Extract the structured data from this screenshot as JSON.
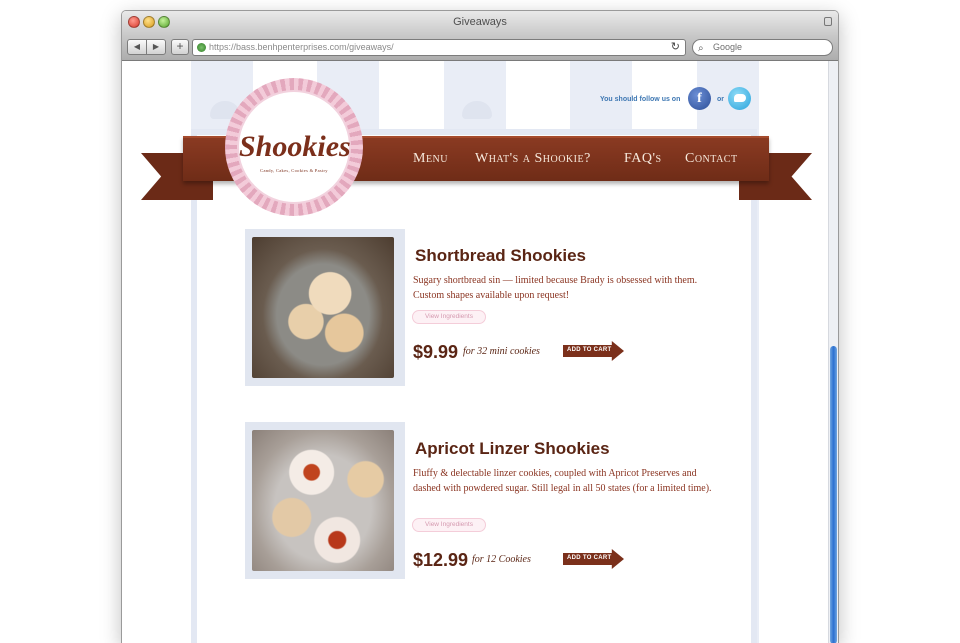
{
  "browser": {
    "window_title": "Giveaways",
    "url": "https://bass.benhpenterprises.com/giveaways/",
    "search_placeholder": "Google",
    "back_label": "◀",
    "forward_label": "▶",
    "add_label": "+",
    "reload_label": "↻"
  },
  "social": {
    "follow_text": "You should follow us on",
    "or_text": "or",
    "facebook_letter": "f"
  },
  "brand": {
    "name": "Shookies",
    "tagline": "Candy, Cakes, Cookies & Pastry"
  },
  "nav": {
    "menu": "Menu",
    "whats": "What's a Shookie?",
    "faq": "FAQ's",
    "contact": "Contact"
  },
  "products": [
    {
      "title": "Shortbread Shookies",
      "description": "Sugary shortbread sin — limited because Brady is obsessed with them. Custom shapes available upon request!",
      "ingredients_label": "View Ingredients",
      "price": "$9.99",
      "price_note": "for 32 mini cookies",
      "cart_label": "ADD TO CART"
    },
    {
      "title": "Apricot Linzer Shookies",
      "description": "Fluffy & delectable linzer cookies, coupled with Apricot Preserves and dashed with powdered sugar. Still legal in all 50 states (for a limited time).",
      "ingredients_label": "View Ingredients",
      "price": "$12.99",
      "price_note": "for 12 Cookies",
      "cart_label": "ADD TO CART"
    }
  ],
  "colors": {
    "ribbon": "#7b301b",
    "accent_brown": "#5a2514",
    "stripe": "#e9edf6",
    "pink": "#f3cbd9"
  }
}
